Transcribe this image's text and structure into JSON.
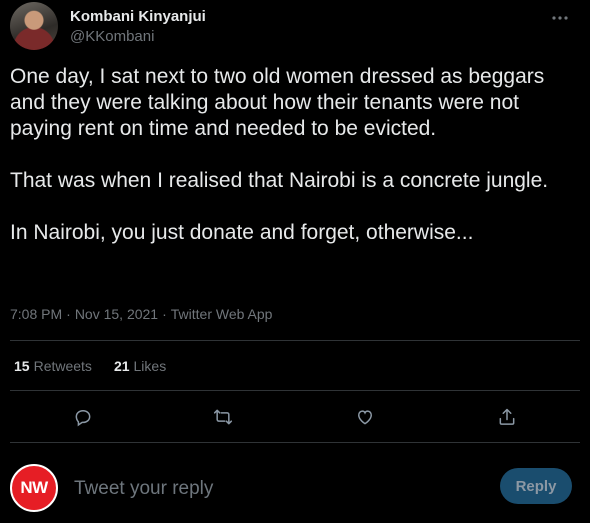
{
  "author": {
    "name": "Kombani Kinyanjui",
    "handle": "@KKombani"
  },
  "tweet": {
    "paragraphs": [
      "One day, I sat next to two old women dressed as beggars and they were talking about how their tenants were not paying rent on time and needed to be evicted.",
      "That was when I realised that Nairobi is a concrete jungle.",
      "In Nairobi, you just donate and forget, otherwise..."
    ],
    "time": "7:08 PM",
    "date": "Nov 15, 2021",
    "source": "Twitter Web App",
    "separator": "·"
  },
  "stats": {
    "retweets_count": "15",
    "retweets_label": "Retweets",
    "likes_count": "21",
    "likes_label": "Likes"
  },
  "actions": {
    "icons": [
      "reply-icon",
      "retweet-icon",
      "like-icon",
      "share-icon"
    ]
  },
  "compose": {
    "avatar_text": "NW",
    "placeholder": "Tweet your reply",
    "button_label": "Reply"
  },
  "colors": {
    "background": "#000000",
    "text": "#e7e9ea",
    "muted": "#71767b",
    "divider": "#2f3336",
    "brand_red": "#e61e25",
    "reply_button": "#1a4d6e"
  }
}
